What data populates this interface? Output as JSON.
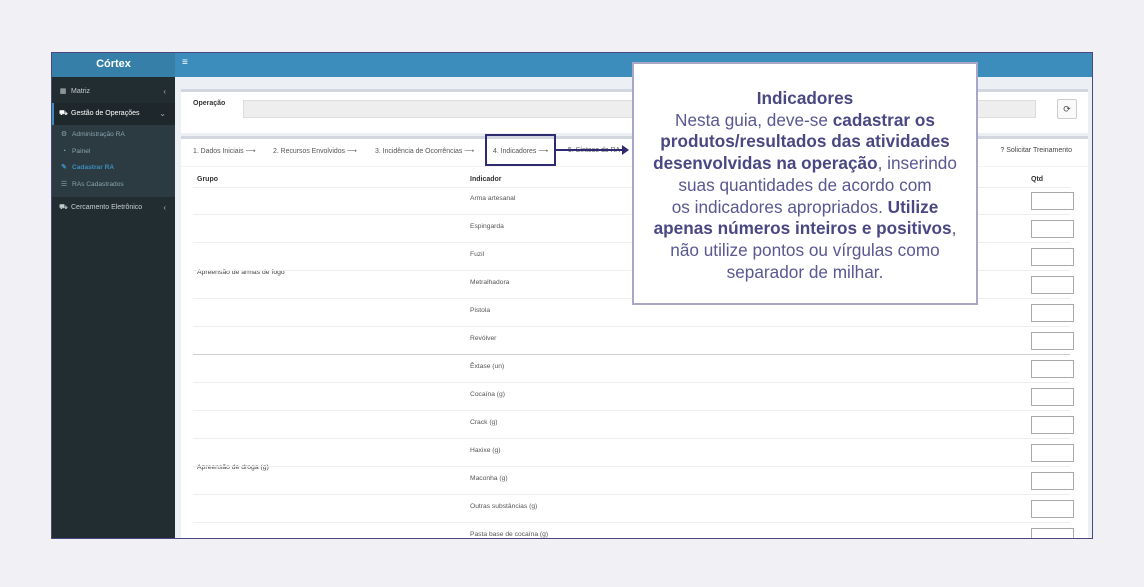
{
  "app": {
    "brand": "Córtex"
  },
  "sidebar": {
    "items": [
      {
        "label": "Matriz",
        "icon": "calendar-icon"
      },
      {
        "label": "Gestão de Operações",
        "icon": "car-icon"
      },
      {
        "label": "Cercamento Eletrônico",
        "icon": "car-icon"
      }
    ],
    "sub_items": [
      {
        "label": "Administração RA",
        "icon": "cogs-icon"
      },
      {
        "label": "Painel",
        "icon": "dashboard-icon"
      },
      {
        "label": "Cadastrar RA",
        "icon": "edit-icon"
      },
      {
        "label": "RAs Cadastrados",
        "icon": "list-icon"
      }
    ]
  },
  "operation": {
    "label": "Operação",
    "value": ""
  },
  "tabs": [
    "1. Dados Iniciais ⟶",
    "2. Recursos Envolvidos ⟶",
    "3. Incidência de Ocorrências ⟶",
    "4. Indicadores ⟶",
    "5. Síntese do RA"
  ],
  "training_link": "Solicitar Treinamento",
  "table": {
    "headers": {
      "group": "Grupo",
      "indicator": "Indicador",
      "qty": "Qtd"
    },
    "groups": [
      {
        "name": "Apreensão de armas de fogo",
        "indicators": [
          "Arma artesanal",
          "Espingarda",
          "Fuzil",
          "Metralhadora",
          "Pistola",
          "Revólver"
        ]
      },
      {
        "name": "Apreensão de droga (g)",
        "indicators": [
          "Êxtase (un)",
          "Cocaína (g)",
          "Crack (g)",
          "Haxixe (g)",
          "Maconha (g)",
          "Outras substâncias (g)",
          "Pasta base de cocaína (g)"
        ]
      }
    ]
  },
  "callout": {
    "title": "Indicadores",
    "l1": "Nesta guia, deve-se ",
    "l1b": "cadastrar os",
    "l2b": "produtos/resultados das atividades",
    "l3b": "desenvolvidas na operação",
    "l3": ", inserindo",
    "l4": "suas quantidades de acordo com",
    "l5": "os indicadores apropriados. ",
    "l5b": "Utilize",
    "l6b": "apenas números inteiros e positivos",
    "l6": ",",
    "l7": "não utilize pontos ou vírgulas como",
    "l8": "separador de milhar."
  },
  "colors": {
    "header_blue": "#3c8dbc",
    "brand_blue": "#367fa9",
    "sidebar_dark": "#222d32",
    "callout_accent": "#2f2b70"
  }
}
